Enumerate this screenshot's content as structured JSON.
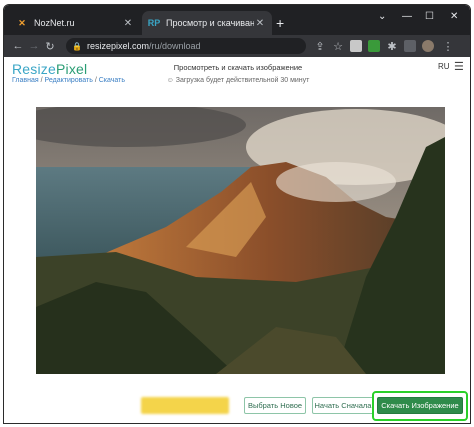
{
  "browser": {
    "tabs": [
      {
        "title": "NozNet.ru",
        "favicon": "noznet-logo-icon",
        "active": false
      },
      {
        "title": "Просмотр и скачивание изобр",
        "favicon": "resizepixel-favicon",
        "active": true
      }
    ],
    "url_host": "resizepixel.com",
    "url_path": "/ru/download"
  },
  "site": {
    "logo_part1": "Resize",
    "logo_part2": "Pixel",
    "breadcrumb": {
      "home": "Главная",
      "edit": "Редактировать",
      "current": "Скачать"
    },
    "heading": "Просмотреть и скачать изображение",
    "notice": "☺ Загрузка будет действительной 30 минут",
    "lang": "RU"
  },
  "buttons": {
    "choose_new": "Выбрать Новое",
    "start_over": "Начать Сначала",
    "download": "Скачать Изображение"
  },
  "colors": {
    "accent": "#2e8b4a",
    "highlight": "#2ad02a",
    "logo": "#3aa6c6"
  }
}
